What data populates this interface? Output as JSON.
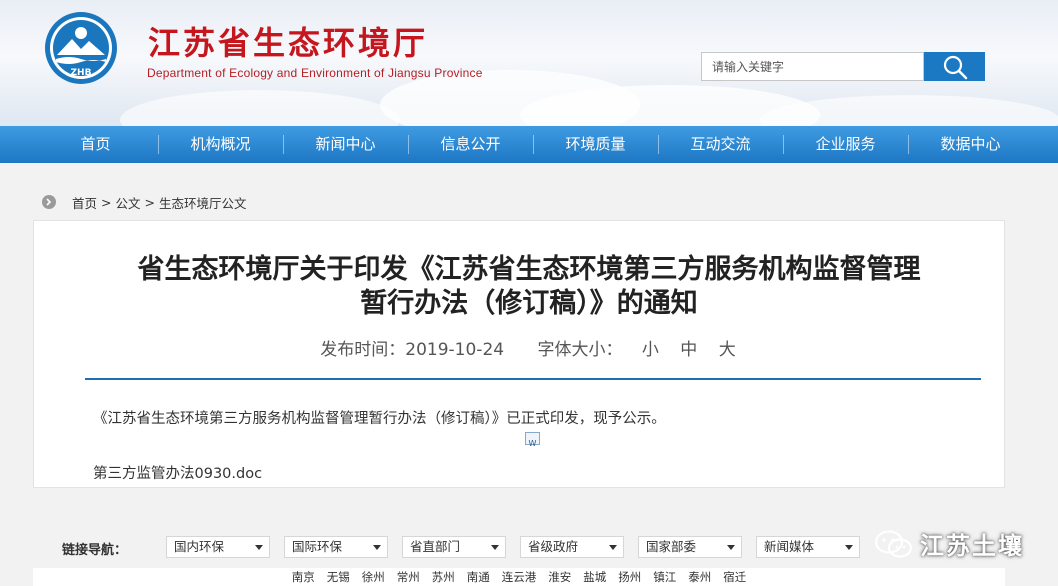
{
  "site": {
    "title": "江苏省生态环境厅",
    "subtitle": "Department of Ecology and Environment of Jiangsu Province",
    "logo_text": "ZHB"
  },
  "search": {
    "placeholder": "请输入关键字"
  },
  "nav": [
    "首页",
    "机构概况",
    "新闻中心",
    "信息公开",
    "环境质量",
    "互动交流",
    "企业服务",
    "数据中心"
  ],
  "breadcrumb": {
    "items": [
      "首页",
      "公文",
      "生态环境厅公文"
    ],
    "separator": ">"
  },
  "article": {
    "title_line1": "省生态环境厅关于印发《江苏省生态环境第三方服务机构监督管理",
    "title_line2": "暂行办法（修订稿）》的通知",
    "publish_label": "发布时间：",
    "publish_date": "2019-10-24",
    "font_size_label": "字体大小：",
    "font_sizes": [
      "小",
      "中",
      "大"
    ],
    "body": "《江苏省生态环境第三方服务机构监督管理暂行办法（修订稿）》已正式印发，现予公示。",
    "attachment": "第三方监管办法0930.doc"
  },
  "links": {
    "label": "链接导航：",
    "selects": [
      "国内环保",
      "国际环保",
      "省直部门",
      "省级政府",
      "国家部委",
      "新闻媒体"
    ]
  },
  "watermark": "江苏土壤",
  "cities": [
    "南京",
    "无锡",
    "徐州",
    "常州",
    "苏州",
    "南通",
    "连云港",
    "淮安",
    "盐城",
    "扬州",
    "镇江",
    "泰州",
    "宿迁"
  ],
  "colors": {
    "brand_red": "#c4161c",
    "nav_blue": "#1d77c4",
    "rule_blue": "#1d6fb2"
  }
}
